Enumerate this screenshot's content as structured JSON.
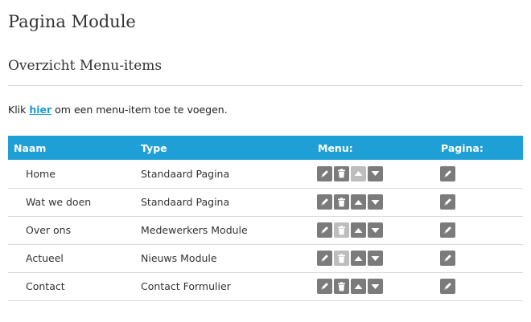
{
  "page_title": "Pagina Module",
  "section_title": "Overzicht Menu-items",
  "intro": {
    "prefix": "Klik ",
    "link": "hier",
    "suffix": " om een menu-item toe te voegen."
  },
  "table": {
    "headers": [
      "Naam",
      "Type",
      "Menu:",
      "Pagina:"
    ],
    "rows": [
      {
        "name": "Home",
        "type": "Standaard Pagina",
        "delete_enabled": true,
        "up_enabled": false,
        "down_enabled": true
      },
      {
        "name": "Wat we doen",
        "type": "Standaard Pagina",
        "delete_enabled": true,
        "up_enabled": true,
        "down_enabled": true
      },
      {
        "name": "Over ons",
        "type": "Medewerkers Module",
        "delete_enabled": false,
        "up_enabled": true,
        "down_enabled": true
      },
      {
        "name": "Actueel",
        "type": "Nieuws Module",
        "delete_enabled": false,
        "up_enabled": true,
        "down_enabled": true
      },
      {
        "name": "Contact",
        "type": "Contact Formulier",
        "delete_enabled": true,
        "up_enabled": true,
        "down_enabled": true
      }
    ]
  },
  "colors": {
    "header_bg": "#1e9fd6",
    "link": "#1a9cd2",
    "icon_enabled": "#7b7b7b",
    "icon_disabled": "#bdbdbd"
  },
  "icons": {
    "edit": "pencil-icon",
    "delete": "trash-icon",
    "up": "arrow-up-icon",
    "down": "arrow-down-icon"
  }
}
